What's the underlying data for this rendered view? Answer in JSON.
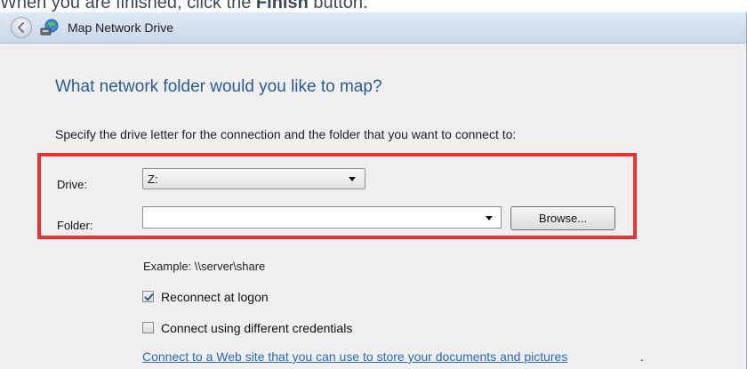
{
  "caption": {
    "prefix": "When you are finished, click the ",
    "bold": "Finish",
    "suffix": " button."
  },
  "window": {
    "title": "Map Network Drive",
    "icons": {
      "back": "back-arrow-icon",
      "app": "network-drive-icon"
    }
  },
  "dialog": {
    "heading": "What network folder would you like to map?",
    "instruction": "Specify the drive letter for the connection and the folder that you want to connect to:",
    "drive": {
      "label": "Drive:",
      "value": "Z:"
    },
    "folder": {
      "label": "Folder:",
      "value": "",
      "placeholder": ""
    },
    "browse_label": "Browse...",
    "example": "Example: \\\\server\\share",
    "reconnect": {
      "label": "Reconnect at logon",
      "checked": true
    },
    "credentials": {
      "label": "Connect using different credentials",
      "checked": false
    },
    "web_link": "Connect to a Web site that you can use to store your documents and pictures",
    "web_link_suffix": "."
  },
  "colors": {
    "heading": "#2a5b93",
    "link": "#2a6ab8",
    "highlight_border": "#e8322f",
    "dialog_bg": "#efefef"
  }
}
